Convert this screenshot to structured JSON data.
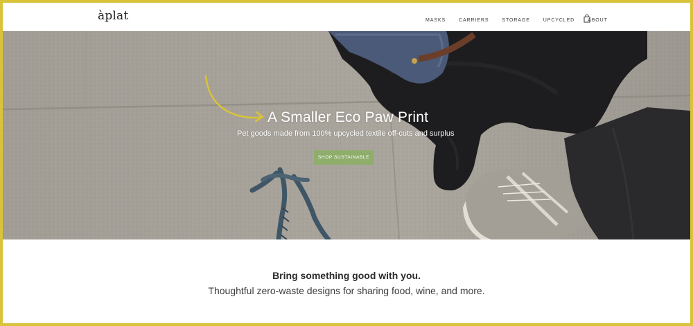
{
  "brand": {
    "logo_text": "àplat"
  },
  "nav": {
    "items": [
      {
        "label": "MASKS"
      },
      {
        "label": "CARRIERS"
      },
      {
        "label": "STORAGE"
      },
      {
        "label": "UPCYCLED"
      },
      {
        "label": "ABOUT"
      }
    ],
    "cart_icon": "bag-icon"
  },
  "hero": {
    "title": "A Smaller Eco Paw Print",
    "subtitle": "Pet goods made from 100% upcycled textile off-cuts and surplus",
    "button_label": "SHOP SUSTAINABLE",
    "colors": {
      "button": "#8fae6c",
      "arrow": "#d8c33a",
      "pavement": "#a9a49c"
    }
  },
  "content": {
    "heading": "Bring something good with you.",
    "subheading": "Thoughtful zero-waste designs for sharing food, wine, and more."
  },
  "frame_color": "#d8c33a"
}
